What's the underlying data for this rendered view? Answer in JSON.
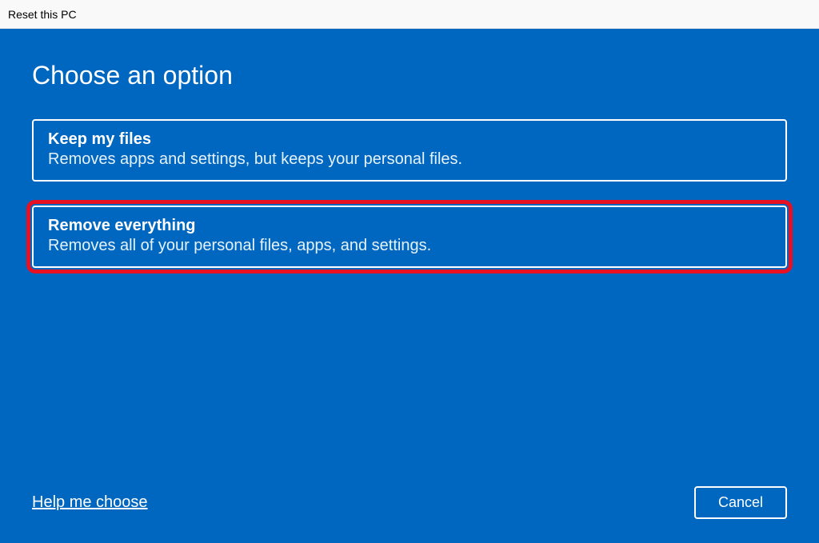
{
  "window": {
    "title": "Reset this PC"
  },
  "page": {
    "heading": "Choose an option"
  },
  "options": [
    {
      "title": "Keep my files",
      "description": "Removes apps and settings, but keeps your personal files.",
      "highlighted": false
    },
    {
      "title": "Remove everything",
      "description": "Removes all of your personal files, apps, and settings.",
      "highlighted": true
    }
  ],
  "footer": {
    "help_link": "Help me choose",
    "cancel_label": "Cancel"
  }
}
